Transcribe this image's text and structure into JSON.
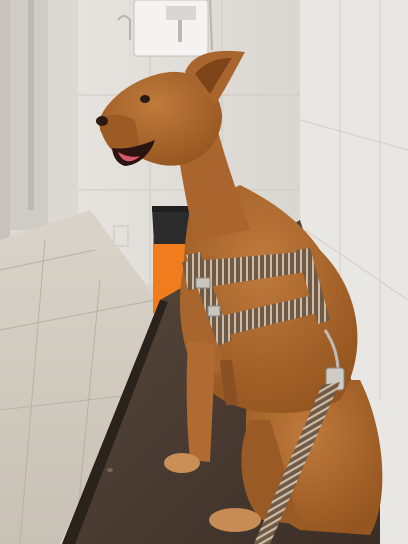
{
  "scene": {
    "subject": "dog",
    "colors": {
      "fur": "#b06b32",
      "fur_dark": "#8a4f22",
      "fur_light": "#c88a4c",
      "harness": "#6f5a47",
      "harness_stripe": "#cdbba3",
      "bench": "#4a3a30",
      "wall": "#eceae6",
      "floor": "#cfc8bd",
      "bin": "#f07c1e",
      "bin_lid": "#2b2b2b",
      "door_frame": "#d9d6d0"
    },
    "icons": [
      "dog",
      "harness",
      "leash",
      "trash-bin",
      "wall-dispenser",
      "exam-bench",
      "floor-tiles"
    ]
  }
}
